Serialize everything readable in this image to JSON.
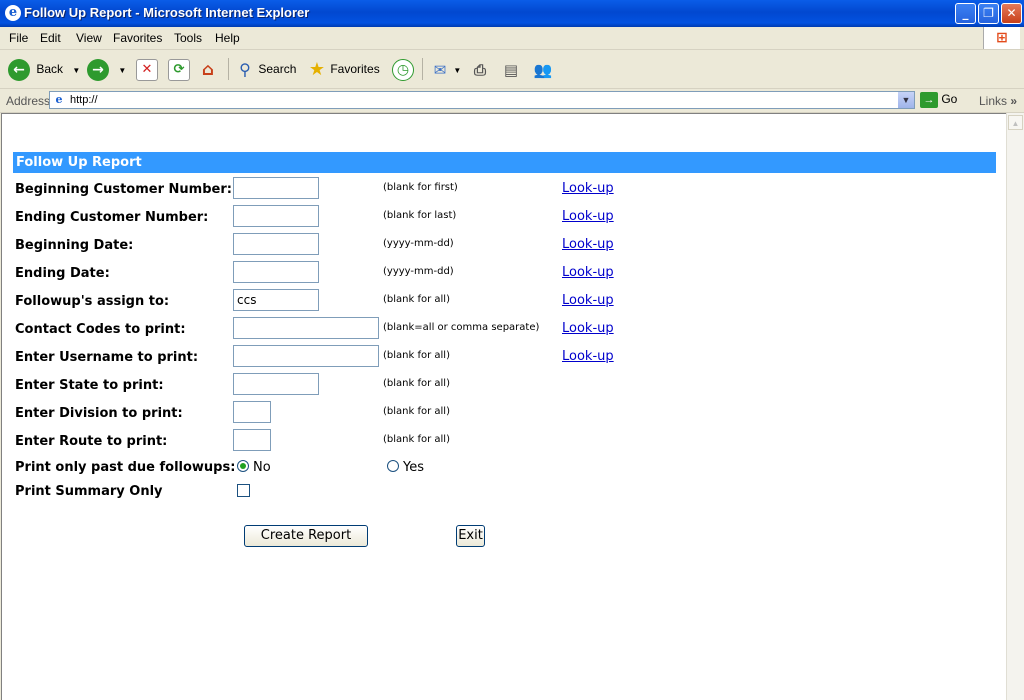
{
  "window": {
    "title": "Follow Up Report - Microsoft Internet Explorer"
  },
  "menu": [
    "File",
    "Edit",
    "View",
    "Favorites",
    "Tools",
    "Help"
  ],
  "toolbar": {
    "back": "Back",
    "search": "Search",
    "favorites": "Favorites"
  },
  "address": {
    "label": "Address",
    "url": "http://",
    "go": "Go",
    "links": "Links"
  },
  "form": {
    "header": "Follow Up Report",
    "rows": [
      {
        "label": "Beginning Customer Number:",
        "value": "",
        "hint": "(blank for first)",
        "lookup": "Look-up"
      },
      {
        "label": "Ending Customer Number:",
        "value": "",
        "hint": "(blank for last)",
        "lookup": "Look-up"
      },
      {
        "label": "Beginning Date:",
        "value": "",
        "hint": "(yyyy-mm-dd)",
        "lookup": "Look-up"
      },
      {
        "label": "Ending Date:",
        "value": "",
        "hint": "(yyyy-mm-dd)",
        "lookup": "Look-up"
      },
      {
        "label": "Followup's assign to:",
        "value": "ccs",
        "hint": "(blank for all)",
        "lookup": "Look-up"
      },
      {
        "label": "Contact Codes to print:",
        "value": "",
        "hint": "(blank=all or comma separate)",
        "lookup": "Look-up"
      },
      {
        "label": "Enter Username to print:",
        "value": "",
        "hint": "(blank for all)",
        "lookup": "Look-up"
      },
      {
        "label": "Enter State to print:",
        "value": "",
        "hint": "(blank for all)"
      },
      {
        "label": "Enter Division to print:",
        "value": "",
        "hint": "(blank for all)"
      },
      {
        "label": "Enter Route to print:",
        "value": "",
        "hint": "(blank for all)"
      }
    ],
    "past_due": {
      "label": "Print only past due followups:",
      "no": "No",
      "yes": "Yes",
      "selected": "No"
    },
    "summary": {
      "label": "Print Summary Only",
      "checked": false
    },
    "create_button": "Create Report",
    "exit_button": "Exit"
  }
}
